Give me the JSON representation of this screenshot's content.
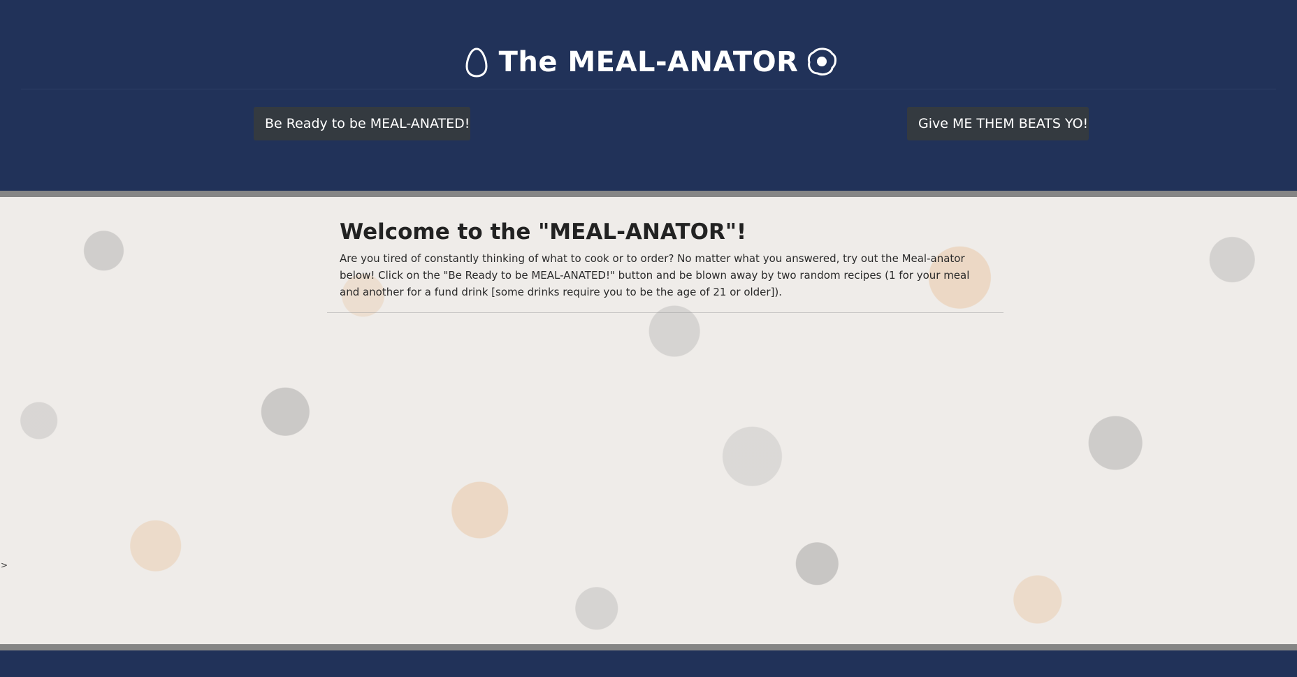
{
  "header": {
    "title": "The MEAL-ANATOR",
    "left_icon": "egg-icon",
    "right_icon": "fried-egg-icon",
    "meal_button_label": "Be Ready to be MEAL-ANATED!",
    "beats_button_label": "Give ME THEM BEATS YO!"
  },
  "main": {
    "welcome_title": "Welcome to the \"MEAL-ANATOR\"!",
    "intro_text": "Are you tired of constantly thinking of what to cook or to order? No matter what you answered, try out the Meal-anator below! Click on the \"Be Ready to be MEAL-ANATED!\" button and be blown away by two random recipes (1 for your meal and another for a fund drink [some drinks require you to be the age of 21 or older]).",
    "side_marker": ">"
  },
  "colors": {
    "header_bg": "#213259",
    "button_bg": "#343a40",
    "stripe": "#858585"
  }
}
